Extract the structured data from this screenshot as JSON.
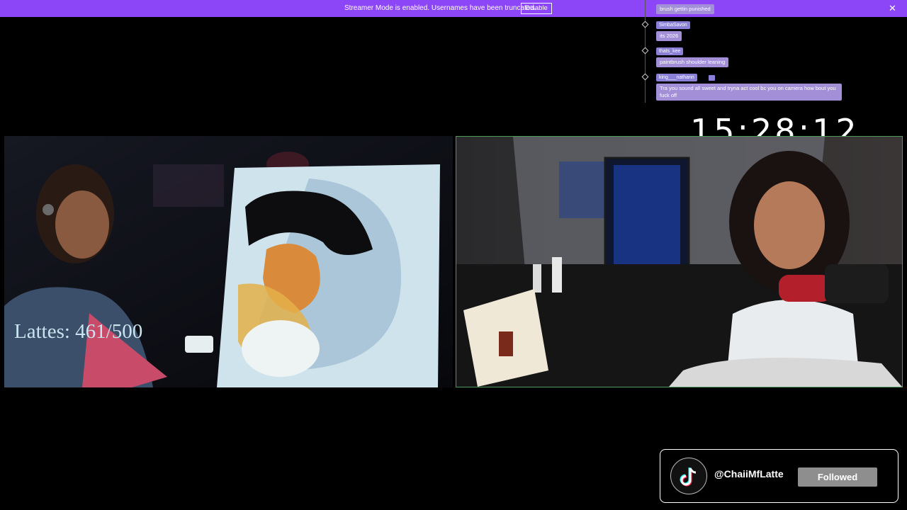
{
  "banner": {
    "text": "Streamer Mode is enabled. Usernames have been truncated.",
    "button_label": "Disable",
    "close_glyph": "✕"
  },
  "chat": {
    "messages": [
      {
        "user": "",
        "text": "brush gettin punished"
      },
      {
        "user": "SimbaSavon",
        "text": "its 2026"
      },
      {
        "user": "thats_kee",
        "text": "paintbrush shoulder leaning"
      },
      {
        "user": "king___nathann",
        "text": "Tra you sound all sweet and tryna act cool bc you on camera how bout you fuck off"
      }
    ]
  },
  "timer": "15:28:12",
  "overlay": {
    "lattes": "Lattes: 461/500"
  },
  "tiktok": {
    "handle": "@ChaiiMfLatte",
    "button_label": "Followed",
    "icon": "tiktok-logo-icon"
  },
  "colors": {
    "banner": "#8c45f7",
    "chat_bubble": "#a28fd8",
    "cam_border": "#4f9a5b"
  }
}
